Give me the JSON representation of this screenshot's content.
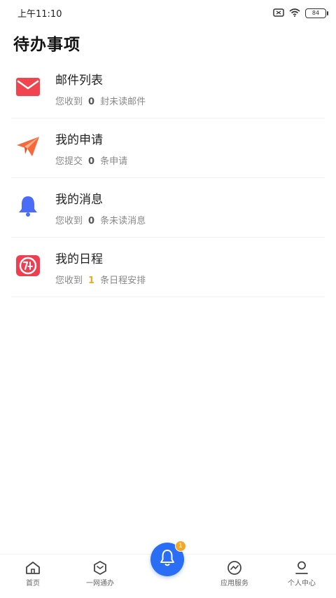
{
  "status_bar": {
    "time": "上午11:10",
    "battery": "84"
  },
  "page_title": "待办事项",
  "todo_items": [
    {
      "title": "邮件列表",
      "prefix": "您收到",
      "count": "0",
      "suffix": "封未读邮件",
      "icon": "mail-icon",
      "icon_color": "#f0454f"
    },
    {
      "title": "我的申请",
      "prefix": "您提交",
      "count": "0",
      "suffix": "条申请",
      "icon": "paper-plane-icon",
      "icon_color": "#f5693a"
    },
    {
      "title": "我的消息",
      "prefix": "您收到",
      "count": "0",
      "suffix": "条未读消息",
      "icon": "bell-icon",
      "icon_color": "#4a6cf7"
    },
    {
      "title": "我的日程",
      "prefix": "您收到",
      "count": "1",
      "suffix": "条日程安排",
      "icon": "calendar-icon",
      "icon_color": "#ee3f52"
    }
  ],
  "tab_bar": {
    "tabs": [
      {
        "label": "首页",
        "icon": "home-icon"
      },
      {
        "label": "一网通办",
        "icon": "hexagon-icon"
      },
      {
        "label": "",
        "icon": "bell-icon"
      },
      {
        "label": "应用服务",
        "icon": "chart-icon"
      },
      {
        "label": "个人中心",
        "icon": "person-icon"
      }
    ],
    "center_badge": "1",
    "accent_color": "#2a6ef5"
  }
}
